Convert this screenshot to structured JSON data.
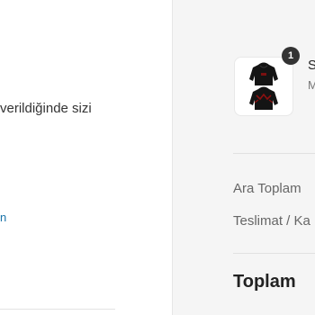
{
  "contact_section": {
    "notice_text": "verildiğinde sizi",
    "link_text": "n"
  },
  "order_summary": {
    "item": {
      "quantity": "1",
      "title": "S",
      "variant": "M",
      "image_icon": "black-hoodie-image"
    },
    "subtotal_label": "Ara Toplam",
    "shipping_label": "Teslimat / Ka",
    "total_label": "Toplam"
  },
  "colors": {
    "summary_background": "#f5f5f5",
    "badge": "#333333",
    "link": "#1a73a8"
  }
}
